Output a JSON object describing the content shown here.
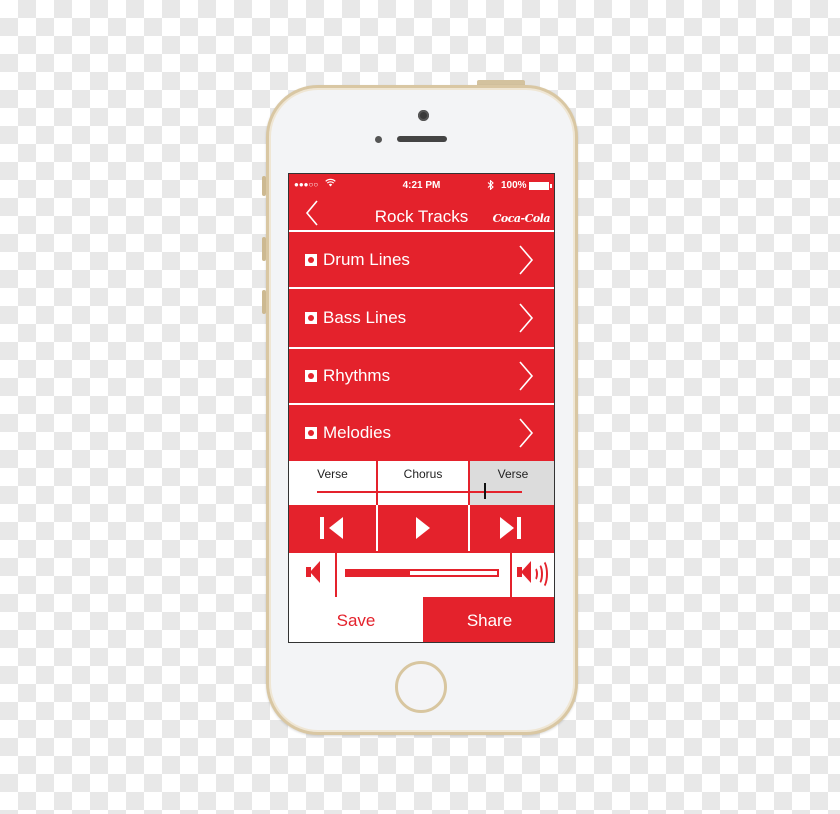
{
  "status_bar": {
    "signal": "●●●○○",
    "wifi_icon": "wifi-icon",
    "time": "4:21 PM",
    "bluetooth_icon": "bluetooth-icon",
    "battery": "100%"
  },
  "nav": {
    "back_icon": "chevron-left-icon",
    "title": "Rock Tracks",
    "brand": "Coca-Cola"
  },
  "tracks": [
    {
      "label": "Drum Lines"
    },
    {
      "label": "Bass Lines"
    },
    {
      "label": "Rhythms"
    },
    {
      "label": "Melodies"
    }
  ],
  "segments": [
    {
      "label": "Verse",
      "active": false
    },
    {
      "label": "Chorus",
      "active": false
    },
    {
      "label": "Verse",
      "active": true
    }
  ],
  "playback": {
    "position_fraction": 0.82,
    "controls": [
      "skip-back-icon",
      "play-icon",
      "skip-forward-icon"
    ]
  },
  "volume": {
    "level_fraction": 0.42
  },
  "actions": {
    "save": "Save",
    "share": "Share"
  },
  "colors": {
    "accent": "#e4222c",
    "active_segment": "#dcdcdc"
  }
}
